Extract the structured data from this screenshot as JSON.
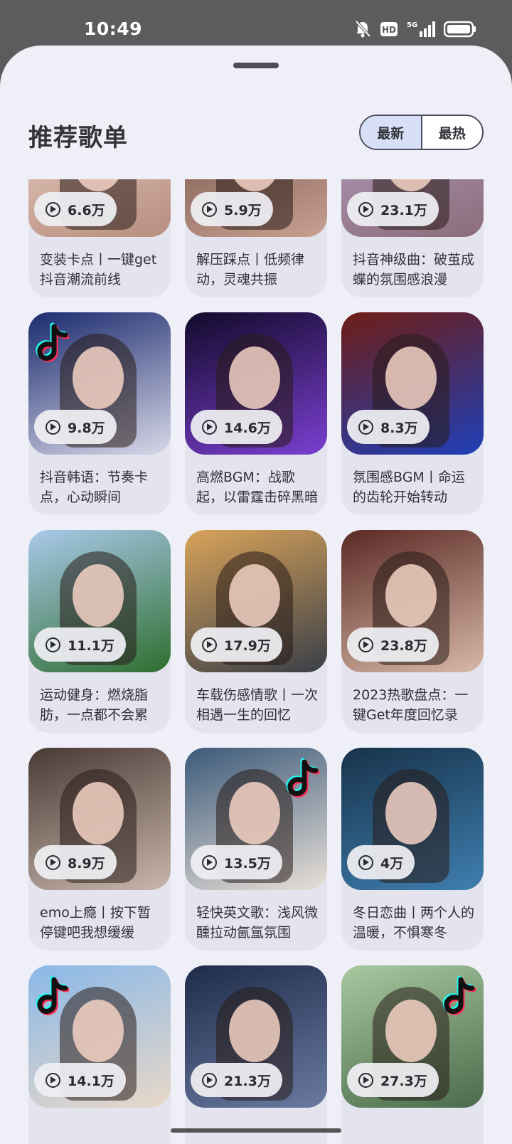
{
  "status_bar": {
    "time": "10:49",
    "icons": [
      "bell-off-icon",
      "hd-icon",
      "signal-5g-icon",
      "battery-icon"
    ],
    "network_label": "5G"
  },
  "sheet": {
    "title": "推荐歌单",
    "sort": {
      "options": [
        "最新",
        "最热"
      ],
      "selected": "最新"
    }
  },
  "playlists": [
    {
      "plays": "6.6万",
      "title": "变装卡点丨一键get抖音潮流前线",
      "colors": [
        "#e8d4c8",
        "#b88d7e"
      ],
      "logo": true
    },
    {
      "plays": "5.9万",
      "title": "解压踩点丨低频律动，灵魂共振",
      "colors": [
        "#6b4a44",
        "#c7a090"
      ],
      "logo": false
    },
    {
      "plays": "23.1万",
      "title": "抖音神级曲：破茧成蝶的氛围感浪漫",
      "colors": [
        "#b6a3c6",
        "#8b6c7a"
      ],
      "logo": true
    },
    {
      "plays": "9.8万",
      "title": "抖音韩语：节奏卡点，心动瞬间",
      "colors": [
        "#1a2b6e",
        "#d8d8e8"
      ],
      "logo": true
    },
    {
      "plays": "14.6万",
      "title": "高燃BGM：战歌起，以雷霆击碎黑暗",
      "colors": [
        "#120a2a",
        "#7b3fd1"
      ],
      "logo": false
    },
    {
      "plays": "8.3万",
      "title": "氛围感BGM丨命运的齿轮开始转动",
      "colors": [
        "#6e1d15",
        "#1f3fb8"
      ],
      "logo": false
    },
    {
      "plays": "11.1万",
      "title": "运动健身：燃烧脂肪，一点都不会累",
      "colors": [
        "#a9c9ea",
        "#2f6e2f"
      ],
      "logo": false
    },
    {
      "plays": "17.9万",
      "title": "车载伤感情歌丨一次相遇一生的回忆",
      "colors": [
        "#d9a35a",
        "#3a3f48"
      ],
      "logo": false
    },
    {
      "plays": "23.8万",
      "title": "2023热歌盘点：一键Get年度回忆录",
      "colors": [
        "#5a2a24",
        "#d8b8a8"
      ],
      "logo": false
    },
    {
      "plays": "8.9万",
      "title": "emo上瘾丨按下暂停键吧我想缓缓",
      "colors": [
        "#4a3a34",
        "#c9b7ad"
      ],
      "logo": false
    },
    {
      "plays": "13.5万",
      "title": "轻快英文歌：浅风微醺拉动氤氲氛围",
      "colors": [
        "#3c5a7a",
        "#e8e0d8"
      ],
      "logo": true
    },
    {
      "plays": "4万",
      "title": "冬日恋曲丨两个人的温暖，不惧寒冬",
      "colors": [
        "#17324a",
        "#3f7fb0"
      ],
      "logo": false
    },
    {
      "plays": "14.1万",
      "title": "",
      "colors": [
        "#8ab8e8",
        "#e8d8c8"
      ],
      "logo": true
    },
    {
      "plays": "21.3万",
      "title": "",
      "colors": [
        "#1e2c4a",
        "#6a7aa0"
      ],
      "logo": false
    },
    {
      "plays": "27.3万",
      "title": "",
      "colors": [
        "#a8c8a0",
        "#4a6a4a"
      ],
      "logo": true
    }
  ]
}
